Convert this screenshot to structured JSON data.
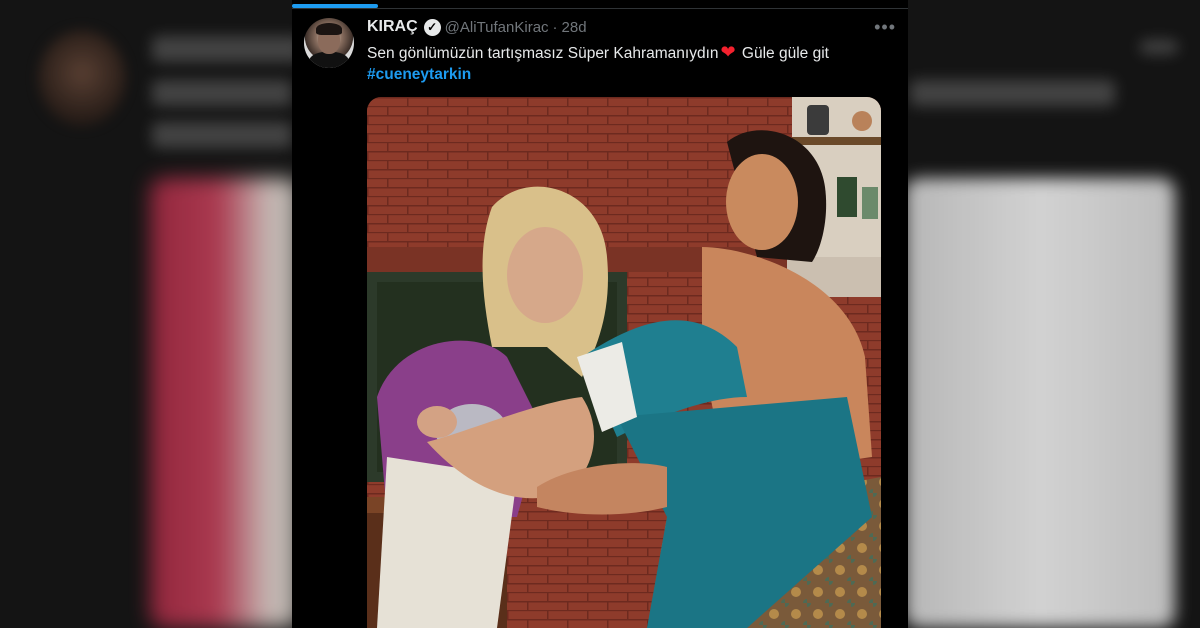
{
  "backdrop": {
    "description_colors": {
      "left": "#c5405a",
      "right": "#e0e0e0"
    }
  },
  "tweet": {
    "author_name": "KIRAÇ",
    "verified": true,
    "handle": "@AliTufanKirac",
    "separator": "·",
    "time": "28d",
    "more_icon": "more-horizontal-icon",
    "text_before_emoji": "Sen gönlümüzün tartışmasız Süper Kahramanıydın",
    "emoji": "❤️",
    "text_after_emoji": " Güle güle git",
    "hashtag": "#cueneytarkin",
    "colors": {
      "accent": "#1d9bf0",
      "heart": "#f4212e",
      "text": "#e7e9ea",
      "muted": "#71767b",
      "background": "#000000"
    }
  }
}
